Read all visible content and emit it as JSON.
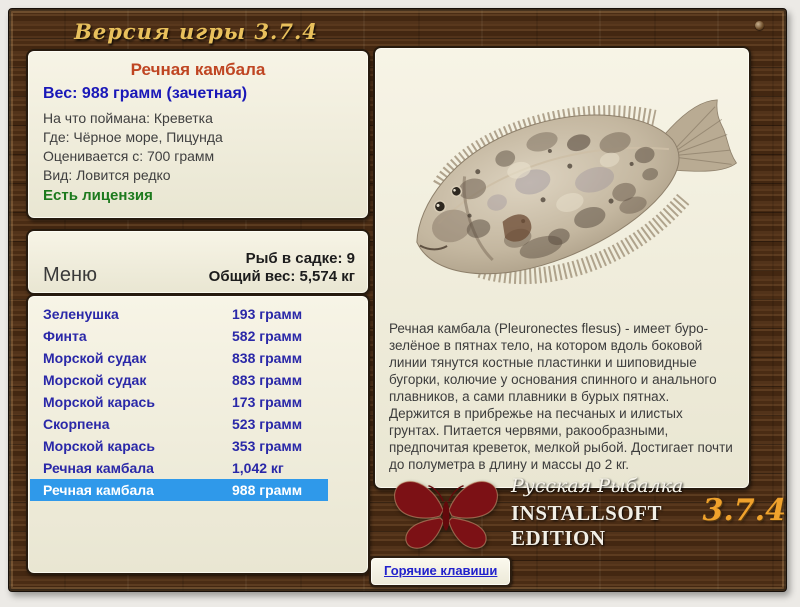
{
  "header": {
    "version_label": "Версия игры  3.7.4"
  },
  "fish_info": {
    "title": "Речная камбала",
    "weight_line": "Вес: 988 грамм (зачетная)",
    "details": [
      "На что поймана: Креветка",
      "Где: Чёрное море, Пицунда",
      "Оценивается с: 700 грамм",
      "Вид: Ловится редко"
    ],
    "license_link": "Есть лицензия"
  },
  "menu_panel": {
    "menu_label": "Меню",
    "fish_count_line": "Рыб в садке: 9",
    "total_weight_line": "Общий вес: 5,574 кг"
  },
  "catch_list": {
    "rows": [
      {
        "name": "Зеленушка",
        "weight": "193 грамм",
        "selected": false
      },
      {
        "name": "Финта",
        "weight": "582 грамм",
        "selected": false
      },
      {
        "name": "Морской судак",
        "weight": "838 грамм",
        "selected": false
      },
      {
        "name": "Морской судак",
        "weight": "883 грамм",
        "selected": false
      },
      {
        "name": "Морской карась",
        "weight": "173 грамм",
        "selected": false
      },
      {
        "name": "Скорпена",
        "weight": "523 грамм",
        "selected": false
      },
      {
        "name": "Морской карась",
        "weight": "353 грамм",
        "selected": false
      },
      {
        "name": "Речная камбала",
        "weight": "1,042 кг",
        "selected": false
      },
      {
        "name": "Речная камбала",
        "weight": "988 грамм",
        "selected": true
      }
    ]
  },
  "description_panel": {
    "image_alt": "flounder-illustration",
    "text": "Речная камбала (Pleuronectes flesus) - имеет буро-зелёное в пятнах тело, на котором вдоль боковой линии тянутся костные пластинки и шиповидные бугорки, колючие у основания спинного и анального плавников, а сами плавники в бурых пятнах. Держится в прибрежье на песчаных и илистых грунтах. Питается червями, ракообразными, предпочитая креветок, мелкой рыбой. Достигает почти до полуметра в длину и массы до 2 кг."
  },
  "branding": {
    "game_name": "Русская Рыбалка",
    "edition": "INSTALLSOFT EDITION",
    "version": "3.7.4",
    "logo": "butterfly-logo"
  },
  "footer": {
    "hotkeys_button": "Горячие клавиши"
  },
  "colors": {
    "accent_red": "#bf4522",
    "accent_blue": "#1a18b8",
    "accent_green": "#1d7a1d",
    "list_blue": "#2a28a8",
    "highlight_bg": "#2f99ea",
    "gold": "#e8c05c",
    "version_orange": "#f0a22c"
  }
}
